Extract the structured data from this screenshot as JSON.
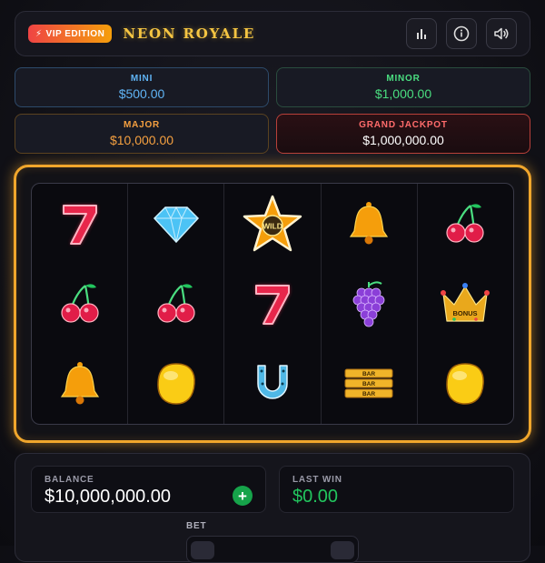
{
  "header": {
    "badge": "VIP EDITION",
    "title": "NEON ROYALE",
    "buttons": [
      {
        "name": "stats-button",
        "icon": "bar-chart-icon"
      },
      {
        "name": "info-button",
        "icon": "info-icon"
      },
      {
        "name": "sound-button",
        "icon": "speaker-icon"
      }
    ]
  },
  "jackpots": {
    "mini": {
      "label": "MINI",
      "value": "$500.00",
      "color": "#60b4f5"
    },
    "minor": {
      "label": "MINOR",
      "value": "$1,000.00",
      "color": "#4ade80"
    },
    "major": {
      "label": "MAJOR",
      "value": "$10,000.00",
      "color": "#f5a040"
    },
    "grand": {
      "label": "GRAND JACKPOT",
      "value": "$1,000,000.00",
      "color": "#ff6b6b"
    }
  },
  "reels": [
    [
      "seven",
      "cherry-pair",
      "bell"
    ],
    [
      "diamond",
      "cherry-pair",
      "gold-coin"
    ],
    [
      "wild-star",
      "seven",
      "horseshoe"
    ],
    [
      "bell",
      "grapes",
      "triple-bar"
    ],
    [
      "cherry-pair",
      "bonus-crown",
      "gold-coin"
    ]
  ],
  "symbol_text": {
    "wild": "WILD",
    "bar": "BAR",
    "bonus": "BONUS"
  },
  "balance": {
    "label": "BALANCE",
    "value": "$10,000,000.00"
  },
  "last_win": {
    "label": "LAST WIN",
    "value": "$0.00"
  },
  "bet": {
    "label": "BET"
  },
  "colors": {
    "accent": "#f0a62c",
    "win": "#22c55e",
    "title": "#f5c542"
  }
}
